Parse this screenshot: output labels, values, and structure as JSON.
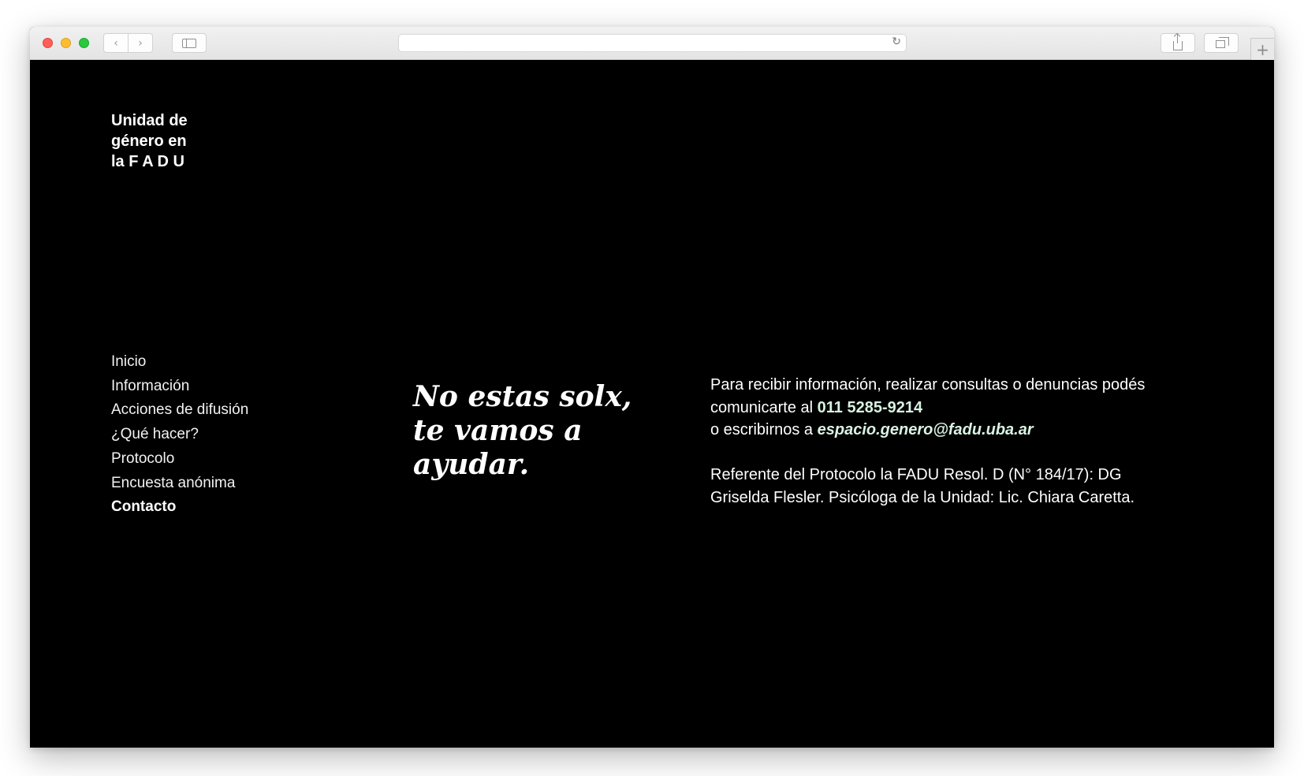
{
  "browser": {
    "url": "",
    "new_tab_label": "+"
  },
  "site": {
    "logo": [
      "Unidad de",
      "género en",
      "la F A D U"
    ],
    "nav": [
      {
        "label": "Inicio",
        "active": false
      },
      {
        "label": "Información",
        "active": false
      },
      {
        "label": "Acciones de difusión",
        "active": false
      },
      {
        "label": "¿Qué hacer?",
        "active": false
      },
      {
        "label": "Protocolo",
        "active": false
      },
      {
        "label": "Encuesta anónima",
        "active": false
      },
      {
        "label": "Contacto",
        "active": true
      }
    ],
    "headline": "No estas solx, te vamos a ayudar.",
    "contact": {
      "line1": "Para recibir información, realizar consultas o denuncias podés comunicarte al",
      "phone": "011 5285-9214",
      "line2": "o escribirnos a",
      "email": "espacio.genero@fadu.uba.ar",
      "referent": "Referente del Protocolo la FADU Resol. D (N° 184/17): DG Griselda Flesler. Psicóloga de la Unidad: Lic. Chiara Caretta."
    },
    "colors": {
      "background": "#000000",
      "text": "#ffffff",
      "link": "#d9f3e3"
    }
  },
  "icons": {
    "back": "chevron-left-icon",
    "forward": "chevron-right-icon",
    "sidebar": "sidebar-icon",
    "reload": "reload-icon",
    "share": "share-icon",
    "tabs": "tabs-overview-icon",
    "new_tab": "plus-icon"
  }
}
